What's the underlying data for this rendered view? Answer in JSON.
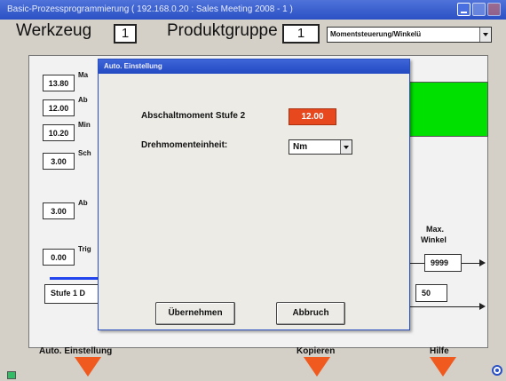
{
  "window": {
    "title": "Basic-Prozessprogrammierung   ( 192.168.0.20 : Sales Meeting 2008 - 1 )"
  },
  "header": {
    "werkzeug_label": "Werkzeug",
    "werkzeug_value": "1",
    "produktgruppe_label": "Produktgruppe",
    "produktgruppe_value": "1",
    "mode_select": "Momentsteuerung/Winkelü"
  },
  "left_values": [
    {
      "value": "13.80",
      "label": "Ma"
    },
    {
      "value": "12.00",
      "label": "Ab"
    },
    {
      "value": "10.20",
      "label": "Min"
    },
    {
      "value": "3.00",
      "label": "Sch"
    },
    {
      "value": "3.00",
      "label": "Ab"
    },
    {
      "value": "0.00",
      "label": "Trig"
    }
  ],
  "stage_label": "Stufe 1 D",
  "right": {
    "max_label_1": "Max.",
    "max_label_2": "Winkel",
    "max_value": "9999",
    "second_value": "50"
  },
  "dialog": {
    "title": "Auto. Einstellung",
    "field1_label": "Abschaltmoment Stufe 2",
    "field1_value": "12.00",
    "field2_label": "Drehmomenteinheit:",
    "field2_value": "Nm",
    "ok_button": "Übernehmen",
    "cancel_button": "Abbruch"
  },
  "bottom": {
    "auto_label": "Auto. Einstellung",
    "copy_label": "Kopieren",
    "help_label": "Hilfe"
  },
  "colors": {
    "accent_orange": "#f05a1e",
    "green_block": "#00e000",
    "title_blue": "#2a50c4"
  }
}
